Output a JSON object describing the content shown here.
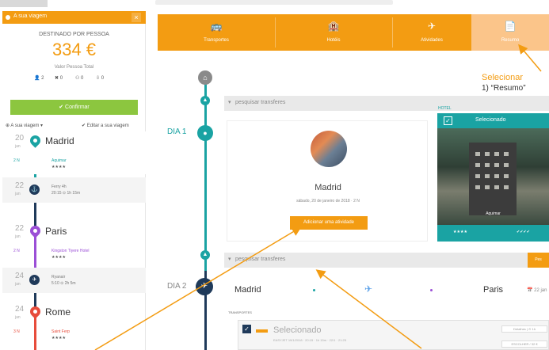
{
  "sidebar": {
    "header": "A sua viagem",
    "close": "×",
    "price_caption": "DESTINADO POR PESSOA",
    "price": "334 €",
    "price_sub": "Valor Pessoa Total",
    "pax": [
      "👤 2",
      "✖ 0",
      "⚇ 0",
      "⇩ 0"
    ],
    "confirm": "✔ Confirmar",
    "links": [
      "⊕ A sua viagem ▾",
      "✔ Editar a sua viagem"
    ],
    "stops": [
      {
        "day": "20",
        "mon": "jan",
        "city": "Madrid",
        "nights": "2 N",
        "hotel": "Aquimar",
        "stars": "★★★★"
      },
      {
        "day": "22",
        "mon": "jan",
        "transit": "Ferry 4h",
        "transit2": "20:15 ⊙ 1h 15m"
      },
      {
        "day": "22",
        "mon": "jan",
        "city": "Paris",
        "nights": "2 N",
        "hotel": "Kingston Tiyere Hotel",
        "stars": "★★★★"
      },
      {
        "day": "24",
        "mon": "jan",
        "transit": "Ryanair",
        "transit2": "5:10 ⊙ 2h 5m"
      },
      {
        "day": "24",
        "mon": "jan",
        "city": "Rome",
        "nights": "3 N",
        "hotel": "Saint Ferp",
        "stars": "★★★★"
      }
    ]
  },
  "nav": {
    "tabs": [
      {
        "icon": "🚌",
        "label": "Transportes"
      },
      {
        "icon": "🏨",
        "label": "Hotéis"
      },
      {
        "icon": "✈",
        "label": "Atividades"
      },
      {
        "icon": "📄",
        "label": "Resumo"
      }
    ]
  },
  "callout": {
    "line1": "Selecionar",
    "line2": "1) “Resumo”"
  },
  "main": {
    "search_bar_1": "pesquisar transferes",
    "search_bar_2": "pesquisar transferes",
    "day1": "DIA 1",
    "day2": "DIA 2",
    "city_name": "Madrid",
    "city_date": "sábado, 20 de janeiro de 2018 · 2 N",
    "activity_btn": "Adicionar uma atividade",
    "hotel_label": "HOTEL",
    "hotel_status": "Selecionado",
    "hotel_name": "Aquimar",
    "hotel_stars": "★★★★",
    "hotel_checks": "✔✔✔✔",
    "side_btn": "Pes",
    "route_from": "Madrid",
    "route_to": "Paris",
    "route_date": "📅 22 jan",
    "transport_label": "TRANSPORTES",
    "transport_status": "Selecionado",
    "transport_detail": "EASYJET 19/1/2018 · 20:15 · 1h 15m · 22/1 · 21:25",
    "transport_right1": "Detalhes | ⊙ 1h",
    "transport_right2": "ESCOLHER / 32 €"
  },
  "colors": {
    "orange": "#f39c12",
    "teal": "#1aa3a3",
    "green": "#8cc63f",
    "navy": "#1f3a5a",
    "purple": "#9b4fd6",
    "red": "#e74c3c"
  }
}
